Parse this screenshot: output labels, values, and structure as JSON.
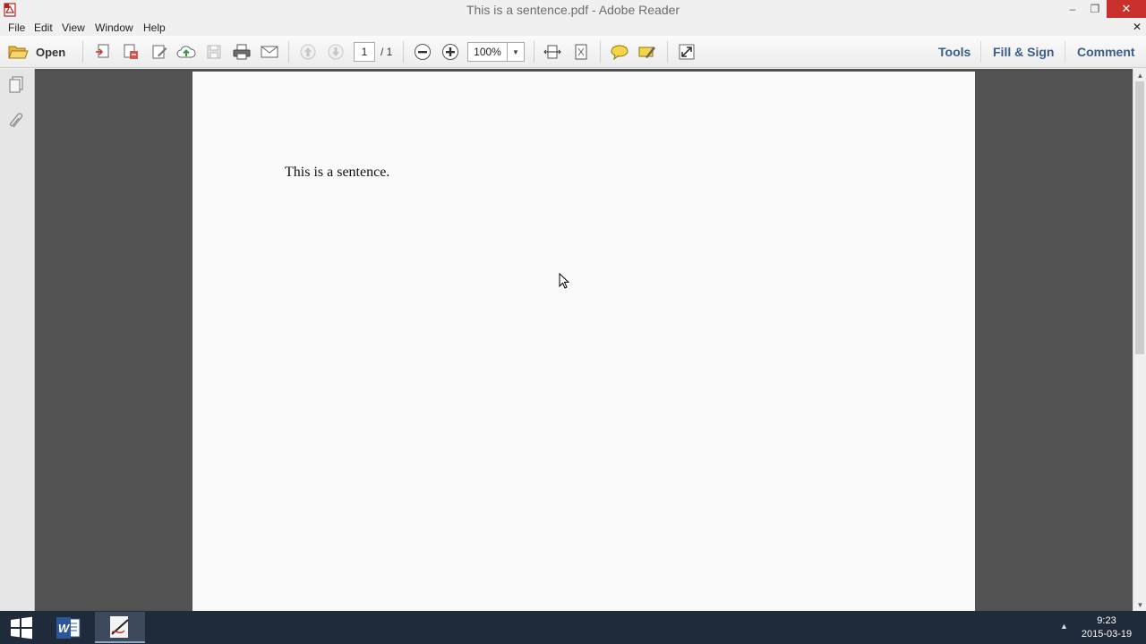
{
  "window": {
    "title": "This is a sentence.pdf - Adobe Reader",
    "min_glyph": "–",
    "max_glyph": "❐",
    "close_glyph": "✕"
  },
  "menu": {
    "items": [
      "File",
      "Edit",
      "View",
      "Window",
      "Help"
    ],
    "doc_close_glyph": "✕"
  },
  "toolbar": {
    "open_label": "Open",
    "page_current": "1",
    "page_total": "/ 1",
    "zoom_value": "100%",
    "zoom_arrow": "▼",
    "tools_label": "Tools",
    "fill_sign_label": "Fill & Sign",
    "comment_label": "Comment"
  },
  "document": {
    "text": "This is a sentence."
  },
  "scrollbar": {
    "up_glyph": "▲",
    "down_glyph": "▼"
  },
  "taskbar": {
    "tray_arrow": "▲",
    "time": "9:23",
    "date": "2015-03-19"
  },
  "colors": {
    "accent_link": "#3a5d8a",
    "close_red": "#c9302c",
    "doc_background": "#525252",
    "taskbar": "#1f2a3a"
  }
}
